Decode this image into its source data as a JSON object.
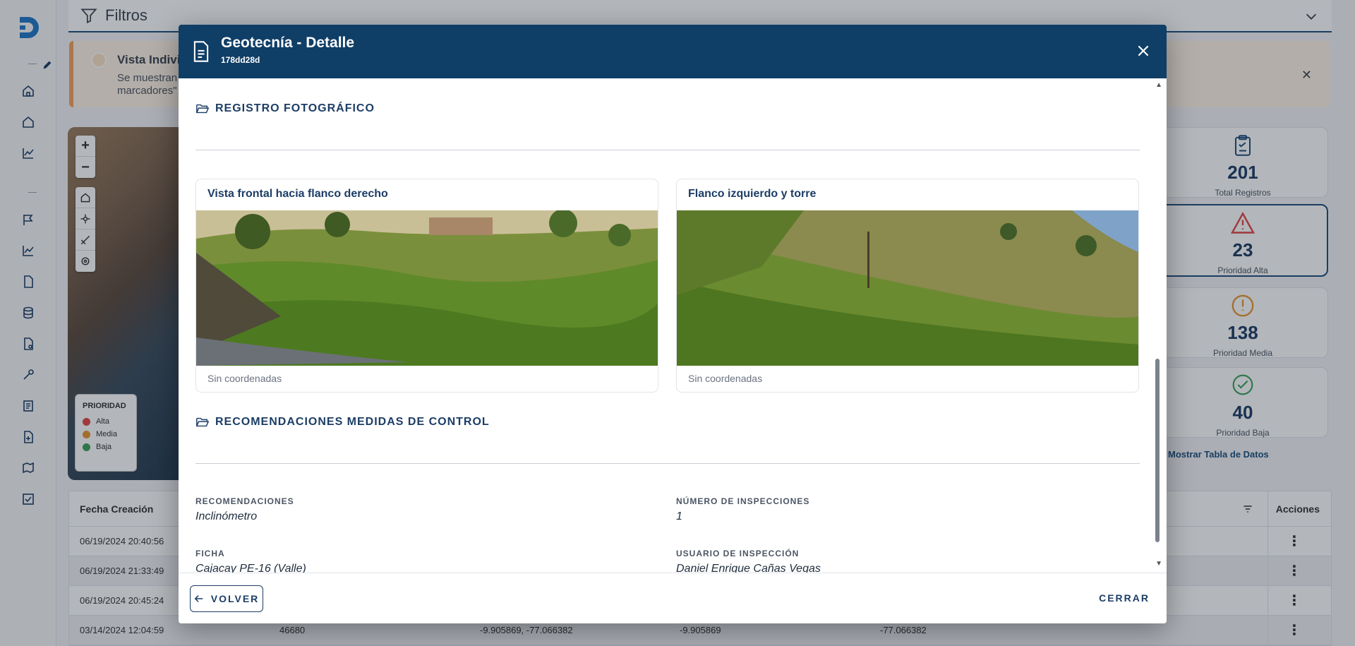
{
  "filters": {
    "label": "Filtros"
  },
  "alert": {
    "title": "Vista Individ",
    "text_line1": "Se muestran",
    "text_line2": "marcadores\""
  },
  "legend": {
    "title": "PRIORIDAD",
    "items": [
      {
        "label": "Alta",
        "color": "#e04848"
      },
      {
        "label": "Media",
        "color": "#e8962e"
      },
      {
        "label": "Baja",
        "color": "#3aa35b"
      }
    ]
  },
  "stats": [
    {
      "value": "201",
      "label": "Total Registros",
      "icon": "clipboard-icon",
      "color": "#1c4f7c"
    },
    {
      "value": "23",
      "label": "Prioridad Alta",
      "icon": "warning-icon",
      "color": "#e04848"
    },
    {
      "value": "138",
      "label": "Prioridad Media",
      "icon": "exclamation-circle-icon",
      "color": "#e8962e"
    },
    {
      "value": "40",
      "label": "Prioridad Baja",
      "icon": "check-circle-icon",
      "color": "#3aa35b"
    }
  ],
  "show_table_label": "Mostrar Tabla de Datos",
  "table": {
    "header_first": "Fecha Creación",
    "header_actions": "Acciones",
    "rows": [
      {
        "date": "06/19/2024 20:40:56"
      },
      {
        "date": "06/19/2024 21:33:49"
      },
      {
        "date": "06/19/2024 20:45:24"
      },
      {
        "date": "03/14/2024 12:04:59",
        "id": "46680",
        "coords": "-9.905869, -77.066382",
        "lat": "-9.905869",
        "lon": "-77.066382"
      }
    ]
  },
  "modal": {
    "title": "Geotecnía - Detalle",
    "subtitle": "178dd28d",
    "section_photos": "REGISTRO FOTOGRÁFICO",
    "photos": [
      {
        "title": "Vista frontal hacia flanco derecho",
        "caption": "Sin coordenadas"
      },
      {
        "title": "Flanco izquierdo y torre",
        "caption": "Sin coordenadas"
      }
    ],
    "section_recs": "RECOMENDACIONES MEDIDAS DE CONTROL",
    "fields": {
      "recomendaciones": {
        "label": "RECOMENDACIONES",
        "value": "Inclinómetro"
      },
      "num_inspecciones": {
        "label": "NÚMERO DE INSPECCIONES",
        "value": "1"
      },
      "ficha": {
        "label": "FICHA",
        "value": "Cajacay PE-16 (Valle)"
      },
      "usuario": {
        "label": "USUARIO DE INSPECCIÓN",
        "value": "Daniel Enrique Cañas Vegas"
      }
    },
    "back_label": "VOLVER",
    "close_label": "CERRAR"
  }
}
